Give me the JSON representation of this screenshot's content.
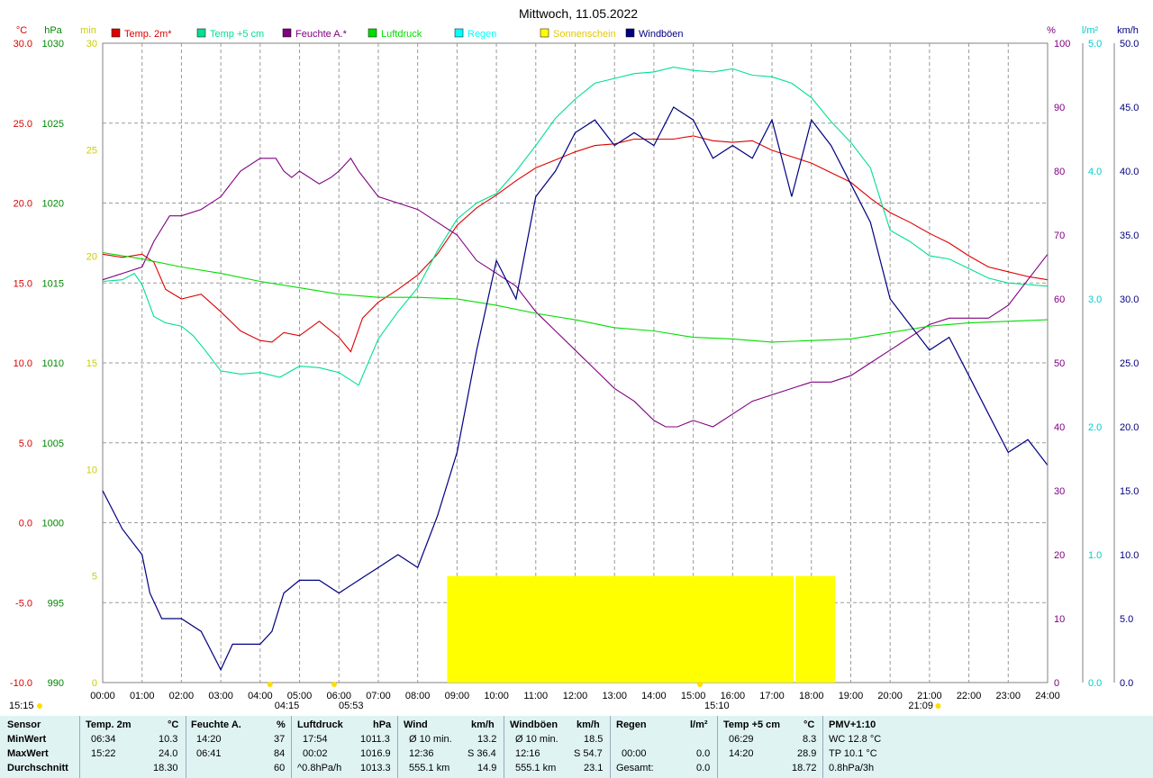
{
  "chart_data": {
    "type": "line",
    "title": "Mittwoch, 11.05.2022",
    "x_ticks": [
      "00:00",
      "01:00",
      "02:00",
      "03:00",
      "04:00",
      "05:00",
      "06:00",
      "07:00",
      "08:00",
      "09:00",
      "10:00",
      "11:00",
      "12:00",
      "13:00",
      "14:00",
      "15:00",
      "16:00",
      "17:00",
      "18:00",
      "19:00",
      "20:00",
      "21:00",
      "22:00",
      "23:00",
      "24:00"
    ],
    "x_range": [
      0,
      24
    ],
    "axes": {
      "temp": {
        "unit": "°C",
        "range": [
          -10,
          30
        ],
        "ticks": [
          "30.0",
          "25.0",
          "20.0",
          "15.0",
          "10.0",
          "5.0",
          "0.0",
          "-5.0",
          "-10.0"
        ],
        "color": "#dd0000"
      },
      "press": {
        "unit": "hPa",
        "range": [
          990,
          1030
        ],
        "ticks": [
          "1030",
          "1025",
          "1020",
          "1015",
          "1010",
          "1005",
          "1000",
          "995",
          "990"
        ],
        "color": "#008800"
      },
      "sun": {
        "unit": "min",
        "range": [
          0,
          30
        ],
        "ticks": [
          "30",
          "25",
          "20",
          "15",
          "10",
          "5",
          "0"
        ],
        "color": "#cccc00"
      },
      "hum": {
        "unit": "%",
        "range": [
          0,
          100
        ],
        "ticks": [
          "100",
          "90",
          "80",
          "70",
          "60",
          "50",
          "40",
          "30",
          "20",
          "10",
          "0"
        ],
        "color": "#800080"
      },
      "rain": {
        "unit": "l/m²",
        "range": [
          0,
          5
        ],
        "ticks": [
          "5.0",
          "4.0",
          "3.0",
          "2.0",
          "1.0",
          "0.0"
        ],
        "color": "#00cccc"
      },
      "wind": {
        "unit": "km/h",
        "range": [
          0,
          50
        ],
        "ticks": [
          "50.0",
          "45.0",
          "40.0",
          "35.0",
          "30.0",
          "25.0",
          "20.0",
          "15.0",
          "10.0",
          "5.0",
          "0.0"
        ],
        "color": "#000080"
      }
    },
    "legend": [
      {
        "name": "Temp. 2m*",
        "color": "#dd0000"
      },
      {
        "name": "Temp +5 cm",
        "color": "#00e090"
      },
      {
        "name": "Feuchte A.*",
        "color": "#800080"
      },
      {
        "name": "Luftdruck",
        "color": "#00dd00"
      },
      {
        "name": "Regen",
        "color": "#00ffff"
      },
      {
        "name": "Sonnenschein",
        "color": "#ffff00"
      },
      {
        "name": "Windböen",
        "color": "#000080"
      }
    ],
    "series": [
      {
        "name": "Temp. 2m*",
        "axis": "temp",
        "color": "#dd0000",
        "x": [
          0,
          0.5,
          1,
          1.3,
          1.6,
          2,
          2.5,
          3,
          3.5,
          4,
          4.3,
          4.6,
          5,
          5.5,
          6,
          6.3,
          6.6,
          7,
          7.5,
          8,
          8.5,
          9,
          9.5,
          10,
          10.5,
          11,
          11.5,
          12,
          12.5,
          13,
          13.5,
          14,
          14.5,
          15,
          15.5,
          16,
          16.5,
          17,
          17.5,
          18,
          18.5,
          19,
          19.5,
          20,
          20.5,
          21,
          21.5,
          22,
          22.5,
          23,
          23.5,
          24
        ],
        "y": [
          16.8,
          16.6,
          16.8,
          16.3,
          14.6,
          14.0,
          14.3,
          13.2,
          12.0,
          11.4,
          11.3,
          11.9,
          11.7,
          12.6,
          11.6,
          10.7,
          12.8,
          13.8,
          14.6,
          15.5,
          16.8,
          18.6,
          19.7,
          20.5,
          21.4,
          22.2,
          22.7,
          23.2,
          23.6,
          23.7,
          24.0,
          24.0,
          24.0,
          24.2,
          23.9,
          23.8,
          23.9,
          23.3,
          22.9,
          22.5,
          21.9,
          21.3,
          20.3,
          19.4,
          18.8,
          18.1,
          17.5,
          16.7,
          16.0,
          15.7,
          15.4,
          15.2
        ]
      },
      {
        "name": "Temp +5 cm",
        "axis": "temp",
        "color": "#00e090",
        "x": [
          0,
          0.5,
          0.8,
          1,
          1.3,
          1.6,
          2,
          2.3,
          2.6,
          3,
          3.5,
          4,
          4.5,
          5,
          5.5,
          6,
          6.5,
          7,
          7.5,
          8,
          8.5,
          9,
          9.5,
          10,
          10.5,
          11,
          11.5,
          12,
          12.5,
          13,
          13.5,
          14,
          14.5,
          15,
          15.5,
          16,
          16.5,
          17,
          17.5,
          18,
          18.5,
          19,
          19.5,
          20,
          20.5,
          21,
          21.5,
          22,
          22.5,
          23,
          23.5,
          24
        ],
        "y": [
          15.1,
          15.2,
          15.6,
          14.9,
          12.9,
          12.5,
          12.3,
          11.7,
          10.8,
          9.5,
          9.3,
          9.4,
          9.1,
          9.8,
          9.7,
          9.4,
          8.6,
          11.5,
          13.2,
          14.7,
          17.0,
          19.0,
          20.0,
          20.6,
          22.0,
          23.6,
          25.3,
          26.5,
          27.5,
          27.8,
          28.1,
          28.2,
          28.5,
          28.3,
          28.2,
          28.4,
          28.0,
          27.9,
          27.5,
          26.6,
          25.1,
          23.8,
          22.2,
          18.3,
          17.6,
          16.7,
          16.5,
          15.9,
          15.3,
          15.0,
          14.9,
          14.8
        ]
      },
      {
        "name": "Feuchte A.*",
        "axis": "hum",
        "color": "#800080",
        "x": [
          0,
          0.5,
          1,
          1.3,
          1.7,
          2,
          2.5,
          3,
          3.5,
          4,
          4.4,
          4.6,
          4.8,
          5,
          5.5,
          5.8,
          6,
          6.3,
          6.5,
          7,
          7.5,
          8,
          8.5,
          9,
          9.5,
          10,
          10.5,
          11,
          11.5,
          12,
          12.5,
          13,
          13.5,
          14,
          14.3,
          14.6,
          15,
          15.5,
          16,
          16.5,
          17,
          17.5,
          18,
          18.5,
          19,
          19.5,
          20,
          20.5,
          21,
          21.5,
          22,
          22.5,
          23,
          23.5,
          24
        ],
        "y": [
          63,
          64,
          65,
          69,
          73,
          73,
          74,
          76,
          80,
          82,
          82,
          80,
          79,
          80,
          78,
          79,
          80,
          82,
          80,
          76,
          75,
          74,
          72,
          70,
          66,
          64,
          62,
          58,
          55,
          52,
          49,
          46,
          44,
          41,
          40,
          40,
          41,
          40,
          42,
          44,
          45,
          46,
          47,
          47,
          48,
          50,
          52,
          54,
          56,
          57,
          57,
          57,
          59,
          63,
          67
        ]
      },
      {
        "name": "Luftdruck",
        "axis": "press",
        "color": "#00dd00",
        "x": [
          0,
          1,
          2,
          3,
          4,
          5,
          6,
          7,
          8,
          9,
          10,
          11,
          12,
          13,
          14,
          15,
          16,
          17,
          18,
          19,
          20,
          21,
          22,
          23,
          24
        ],
        "y": [
          1016.9,
          1016.5,
          1016.0,
          1015.6,
          1015.1,
          1014.7,
          1014.3,
          1014.1,
          1014.1,
          1014.0,
          1013.6,
          1013.1,
          1012.7,
          1012.2,
          1012.0,
          1011.6,
          1011.5,
          1011.3,
          1011.4,
          1011.5,
          1011.9,
          1012.3,
          1012.5,
          1012.6,
          1012.7
        ]
      },
      {
        "name": "Windböen",
        "axis": "wind",
        "color": "#000080",
        "x": [
          0,
          0.5,
          1,
          1.2,
          1.5,
          2,
          2.5,
          3,
          3.3,
          3.6,
          4,
          4.3,
          4.6,
          5,
          5.5,
          6,
          6.5,
          7,
          7.5,
          8,
          8.5,
          9,
          9.5,
          10,
          10.5,
          11,
          11.5,
          12,
          12.5,
          13,
          13.5,
          14,
          14.5,
          15,
          15.5,
          16,
          16.5,
          17,
          17.5,
          18,
          18.5,
          19,
          19.5,
          20,
          20.5,
          21,
          21.5,
          22,
          22.5,
          23,
          23.5,
          24
        ],
        "y": [
          15,
          12,
          10,
          7,
          5,
          5,
          4,
          1,
          3,
          3,
          3,
          4,
          7,
          8,
          8,
          7,
          8,
          9,
          10,
          9,
          13,
          18,
          26,
          33,
          30,
          38,
          40,
          43,
          44,
          42,
          43,
          42,
          45,
          44,
          41,
          42,
          41,
          44,
          38,
          44,
          42,
          39,
          36,
          30,
          28,
          26,
          27,
          24,
          21,
          18,
          19,
          17
        ]
      }
    ],
    "wind_spike_range": [
      [
        0,
        0
      ],
      [
        0,
        0
      ]
    ],
    "sunshine": [
      {
        "start": 8.75,
        "end": 17.55,
        "minutes": 5
      },
      {
        "start": 17.6,
        "end": 18.6,
        "minutes": 5
      }
    ],
    "x_markers": [
      {
        "label": "15:15",
        "hour": 0
      },
      {
        "label": "04:15",
        "hour": 4.25
      },
      {
        "label": "05:53",
        "hour": 5.88
      },
      {
        "label": "15:10",
        "hour": 15.17
      },
      {
        "label": "21:09",
        "hour": 21.15
      }
    ]
  },
  "footer": {
    "rows": [
      "Sensor",
      "MinWert",
      "MaxWert",
      "Durchschnitt"
    ],
    "temp2m": {
      "title": "Temp. 2m",
      "unit": "°C",
      "min_time": "06:34",
      "min": "10.3",
      "max_time": "15:22",
      "max": "24.0",
      "avg": "18.30"
    },
    "humidity": {
      "title": "Feuchte A.",
      "unit": "%",
      "min_time": "14:20",
      "min": "37",
      "max_time": "06:41",
      "max": "84",
      "avg": "60"
    },
    "pressure": {
      "title": "Luftdruck",
      "unit": "hPa",
      "min_time": "17:54",
      "min": "1011.3",
      "max_time": "00:02",
      "max": "1016.9",
      "avg_label": "^0.8hPa/h",
      "avg": "1013.3"
    },
    "wind": {
      "title": "Wind",
      "unit": "km/h",
      "min_label": "Ø 10 min.",
      "min": "13.2",
      "max_time": "12:36",
      "max": "S 36.4",
      "avg_label": "555.1 km",
      "avg": "14.9"
    },
    "gusts": {
      "title": "Windböen",
      "unit": "km/h",
      "min_label": "Ø 10 min.",
      "min": "18.5",
      "max_time": "12:16",
      "max": "S 54.7",
      "avg_label": "555.1 km",
      "avg": "23.1"
    },
    "rain": {
      "title": "Regen",
      "unit": "l/m²",
      "max_time": "00:00",
      "max": "0.0",
      "avg_label": "Gesamt:",
      "avg": "0.0"
    },
    "temp5cm": {
      "title": "Temp +5 cm",
      "unit": "°C",
      "min_time": "06:29",
      "min": "8.3",
      "max_time": "14:20",
      "max": "28.9",
      "avg": "18.72"
    },
    "pmv": {
      "title": "PMV+1:10",
      "min": "WC 12.8 °C",
      "max": "TP 10.1 °C",
      "avg": "0.8hPa/3h"
    }
  }
}
